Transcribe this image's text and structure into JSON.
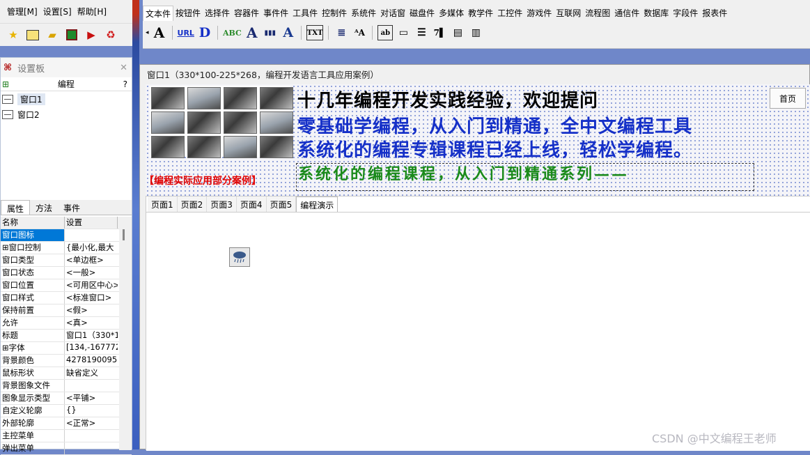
{
  "menu": [
    "管理[M]",
    "设置[S]",
    "帮助[H]"
  ],
  "left_tool_icons": [
    "star-icon",
    "window-icon",
    "folder-icon",
    "save-icon",
    "run-icon",
    "recycle-icon"
  ],
  "toolbar": {
    "tabs": [
      "文本件",
      "按钮件",
      "选择件",
      "容器件",
      "事件件",
      "工具件",
      "控制件",
      "系统件",
      "对话窗",
      "磁盘件",
      "多媒体",
      "教学件",
      "工控件",
      "游戏件",
      "互联网",
      "流程图",
      "通信件",
      "数据库",
      "字段件",
      "报表件"
    ],
    "active_tab": "文本件",
    "icons": [
      {
        "label": "A",
        "name": "label-text-icon"
      },
      {
        "label": "URL",
        "name": "hyperlink-icon"
      },
      {
        "label": "D",
        "name": "bold-d-icon"
      },
      {
        "label": "ABC",
        "name": "abc-text-icon"
      },
      {
        "label": "A",
        "name": "outline-text-icon"
      },
      {
        "label": "▮▮▮",
        "name": "barcode-icon"
      },
      {
        "label": "A",
        "name": "shadow-text-icon"
      },
      {
        "label": "TXT",
        "name": "txt-file-icon"
      },
      {
        "label": "≣",
        "name": "list-text-icon"
      },
      {
        "label": "ᴬA",
        "name": "font-size-icon"
      },
      {
        "label": "ab",
        "name": "textbox-icon"
      },
      {
        "label": "▭",
        "name": "edit-field-icon"
      },
      {
        "label": "☰",
        "name": "memo-icon"
      },
      {
        "label": "7▌",
        "name": "number-edit-icon"
      },
      {
        "label": "▤",
        "name": "rich-text-icon"
      },
      {
        "label": "▥",
        "name": "table-text-icon"
      }
    ]
  },
  "panel": {
    "title": "设置板",
    "tree_header": "编程",
    "tree_help": "?",
    "windows": [
      "窗口1",
      "窗口2"
    ],
    "prop_tabs": [
      "属性",
      "方法",
      "事件"
    ],
    "grid_headers": [
      "名称",
      "设置"
    ],
    "properties": [
      {
        "k": "窗口图标",
        "v": ""
      },
      {
        "k": "⊞窗口控制",
        "v": "{最小化,最大"
      },
      {
        "k": "窗口类型",
        "v": "<单边框>"
      },
      {
        "k": "窗口状态",
        "v": "<一般>"
      },
      {
        "k": "窗口位置",
        "v": "<可用区中心>"
      },
      {
        "k": "窗口样式",
        "v": "<标准窗口>"
      },
      {
        "k": "保持前置",
        "v": "<假>"
      },
      {
        "k": "允许",
        "v": "<真>"
      },
      {
        "k": "标题",
        "v": "窗口1（330*1"
      },
      {
        "k": "⊞字体",
        "v": "[134,-167772"
      },
      {
        "k": "背景颜色",
        "v": "4278190095"
      },
      {
        "k": "鼠标形状",
        "v": "缺省定义"
      },
      {
        "k": "背景图象文件",
        "v": ""
      },
      {
        "k": "图象显示类型",
        "v": "<平铺>"
      },
      {
        "k": "自定义轮廓",
        "v": "{}"
      },
      {
        "k": "外部轮廓",
        "v": "<正常>"
      },
      {
        "k": "主控菜单",
        "v": ""
      },
      {
        "k": "弹出菜单",
        "v": ""
      }
    ]
  },
  "design": {
    "title": "窗口1（330*100-225*268，编程开发语言工具应用案例）",
    "line1": "十几年编程开发实践经验，欢迎提问",
    "line2": "零基础学编程，从入门到精通，全中文编程工具",
    "line3": "系统化的编程专辑课程已经上线，轻松学编程。",
    "home_button": "首页",
    "red_label": "【编程实际应用部分案例】",
    "marquee": "系统化的编程课程，从入门到精通系列——",
    "page_tabs": [
      "页面1",
      "页面2",
      "页面3",
      "页面4",
      "页面5",
      "编程演示"
    ],
    "active_page_tab": "编程演示"
  },
  "watermark": "CSDN @中文编程王老师",
  "colors": {
    "blue_text": "#1530c8",
    "red_text": "#e00000",
    "green_text": "#1a8a1a",
    "selection": "#0078d7"
  }
}
